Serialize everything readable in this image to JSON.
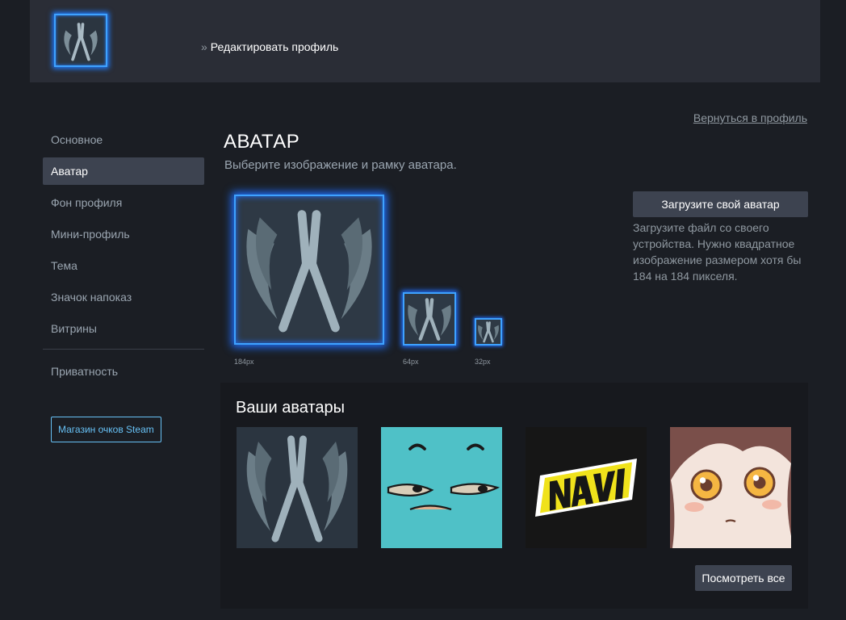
{
  "header": {
    "breadcrumb_separator": "»",
    "breadcrumb_label": "Редактировать профиль"
  },
  "back_link": "Вернуться в профиль",
  "sidebar": {
    "items": [
      {
        "label": "Основное"
      },
      {
        "label": "Аватар"
      },
      {
        "label": "Фон профиля"
      },
      {
        "label": "Мини-профиль"
      },
      {
        "label": "Тема"
      },
      {
        "label": "Значок напоказ"
      },
      {
        "label": "Витрины"
      }
    ],
    "privacy": "Приватность",
    "shop_button": "Магазин очков Steam"
  },
  "main": {
    "title": "АВАТАР",
    "subtitle": "Выберите изображение и рамку аватара.",
    "sizes": [
      "184px",
      "64px",
      "32px"
    ],
    "upload_button": "Загрузите свой аватар",
    "upload_hint": "Загрузите файл со своего устройства. Нужно квадратное изображение размером хотя бы 184 на 184 пикселя."
  },
  "your_avatars": {
    "title": "Ваши аватары",
    "items": [
      {
        "icon": "pliers-wings-icon"
      },
      {
        "icon": "sleepy-face-icon"
      },
      {
        "icon": "navi-logo-icon"
      },
      {
        "icon": "anime-girl-icon"
      }
    ],
    "see_all": "Посмотреть все"
  },
  "colors": {
    "accent": "#67c1f5",
    "frame_glow": "#3ea2ff",
    "button_bg": "#3d4350"
  }
}
